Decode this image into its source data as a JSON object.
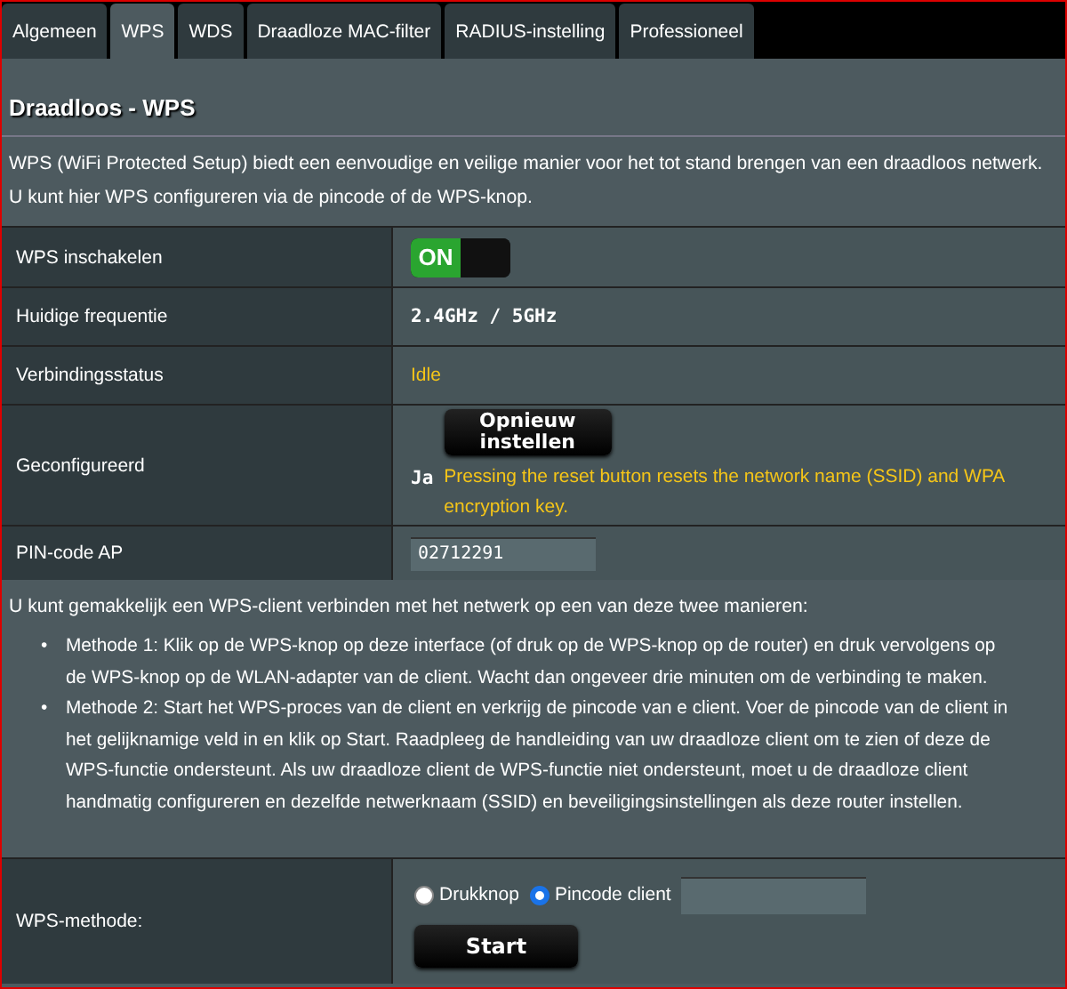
{
  "tabs": [
    {
      "label": "Algemeen",
      "selected": false
    },
    {
      "label": "WPS",
      "selected": true
    },
    {
      "label": "WDS",
      "selected": false
    },
    {
      "label": "Draadloze MAC-filter",
      "selected": false
    },
    {
      "label": "RADIUS-instelling",
      "selected": false
    },
    {
      "label": "Professioneel",
      "selected": false
    }
  ],
  "title": "Draadloos - WPS",
  "intro": "WPS (WiFi Protected Setup) biedt een eenvoudige en veilige manier voor het tot stand brengen van een draadloos netwerk. U kunt hier WPS configureren via de pincode of de WPS-knop.",
  "settings": [
    {
      "kind": "toggle",
      "label": "WPS inschakelen",
      "on": true,
      "text": "ON"
    },
    {
      "kind": "value",
      "label": "Huidige frequentie",
      "value": "2.4GHz / 5GHz"
    },
    {
      "kind": "status",
      "label": "Verbindingsstatus",
      "value": "Idle"
    },
    {
      "kind": "reset",
      "label": "Geconfigureerd",
      "value": "Ja",
      "button": "Opnieuw instellen",
      "note": "Pressing the reset button resets the network name (SSID) and WPA encryption key."
    },
    {
      "kind": "input",
      "label": "PIN-code AP",
      "value": "02712291"
    }
  ],
  "methods_intro": "U kunt gemakkelijk een WPS-client verbinden met het netwerk op een van deze twee manieren:",
  "methods_marker": "•",
  "methods": [
    "Methode 1: Klik op de WPS-knop op deze interface (of druk op de WPS-knop op de router) en druk vervolgens op de WPS-knop op de WLAN-adapter van de client. Wacht dan ongeveer drie minuten om de verbinding te maken.",
    "Methode 2: Start het WPS-proces van de client en verkrijg de pincode van e client. Voer de pincode van de client in het gelijknamige veld in en klik op Start. Raadpleeg de handleiding van uw draadloze client om te zien of deze de WPS-functie ondersteunt. Als uw draadloze client de WPS-functie niet ondersteunt, moet u de draadloze client handmatig configureren en dezelfde netwerknaam (SSID) en beveiligingsinstellingen als deze router instellen."
  ],
  "wps_method": {
    "label": "WPS-methode:",
    "options": [
      {
        "label": "Drukknop",
        "selected": false
      },
      {
        "label": "Pincode client",
        "selected": true
      }
    ],
    "button": "Start"
  }
}
